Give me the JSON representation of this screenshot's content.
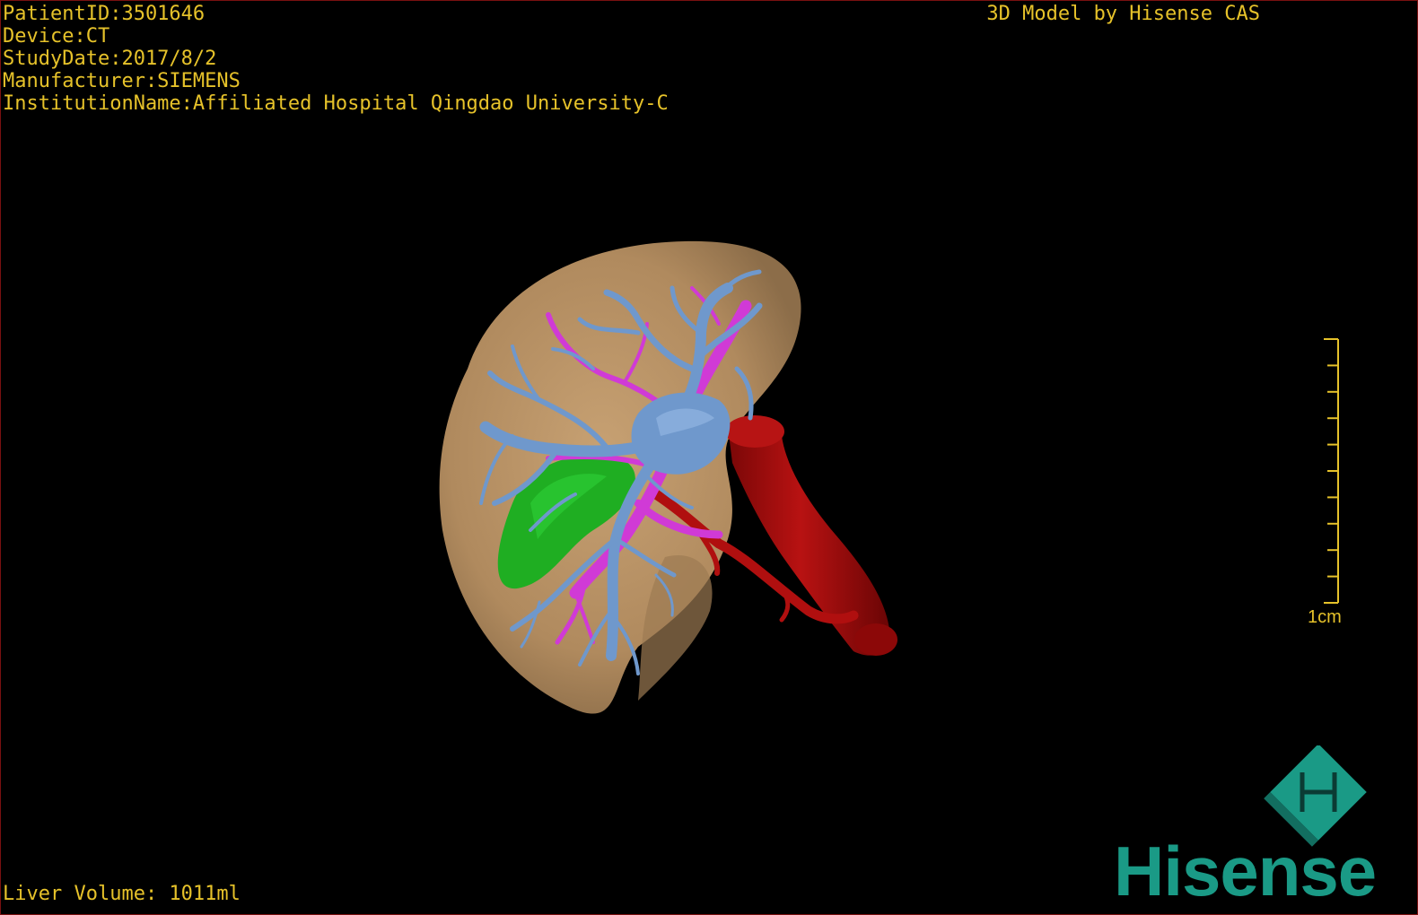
{
  "patient_info": {
    "patient_id": "PatientID:3501646",
    "device": "Device:CT",
    "study_date": "StudyDate:2017/8/2",
    "manufacturer": "Manufacturer:SIEMENS",
    "institution": "InstitutionName:Affiliated Hospital Qingdao University-C"
  },
  "title": "3D Model by Hisense CAS",
  "liver_volume": "Liver Volume: 1011ml",
  "scale": {
    "label": "1cm",
    "tick_count": 10
  },
  "logo": {
    "text": "Hisense",
    "icon": "hisense-cube-icon",
    "color": "#1a9a86"
  },
  "colors": {
    "overlay_text": "#e6c22a",
    "liver": "#b89266",
    "portal_vein": "#6f98cc",
    "hepatic_artery_branch": "#d03ad6",
    "gallbladder": "#1fae22",
    "vena_cava": "#a80b0b"
  }
}
